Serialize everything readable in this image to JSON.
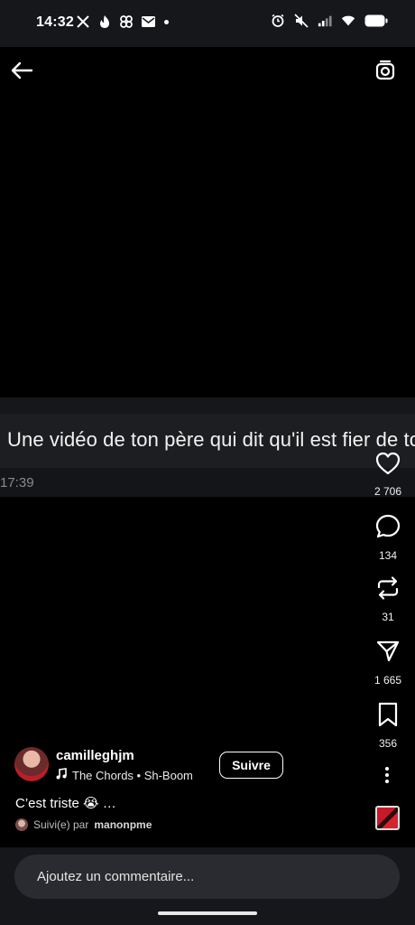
{
  "status_bar": {
    "time": "14:32",
    "left_icons": [
      "x-logo-icon",
      "tinder-flame-icon",
      "pinwheel-icon",
      "mail-icon",
      "dot-icon"
    ],
    "right_icons": [
      "alarm-icon",
      "mute-icon",
      "signal-icon",
      "wifi-icon",
      "battery-icon"
    ]
  },
  "top_bar": {
    "back_icon": "arrow-left-icon",
    "camera_icon": "camera-icon"
  },
  "video": {
    "caption_text": "Une vidéo de ton père qui dit qu'il est fier de to",
    "caption_time": "17:39"
  },
  "actions": {
    "likes": "2 706",
    "comments": "134",
    "reposts": "31",
    "shares": "1 665",
    "saves": "356"
  },
  "post": {
    "username": "camilleghjm",
    "music": "The Chords • Sh-Boom",
    "follow_label": "Suivre",
    "description": "C’est triste 😭 …",
    "followed_prefix": "Suivi(e) par",
    "followed_by": "manonpme"
  },
  "comment_bar": {
    "placeholder": "Ajoutez un commentaire..."
  },
  "colors": {
    "background": "#000000",
    "status_bar_bg": "#16171b",
    "caption_band": "#1d1e21",
    "input_bg": "#2a2b30",
    "text": "#ffffff"
  }
}
